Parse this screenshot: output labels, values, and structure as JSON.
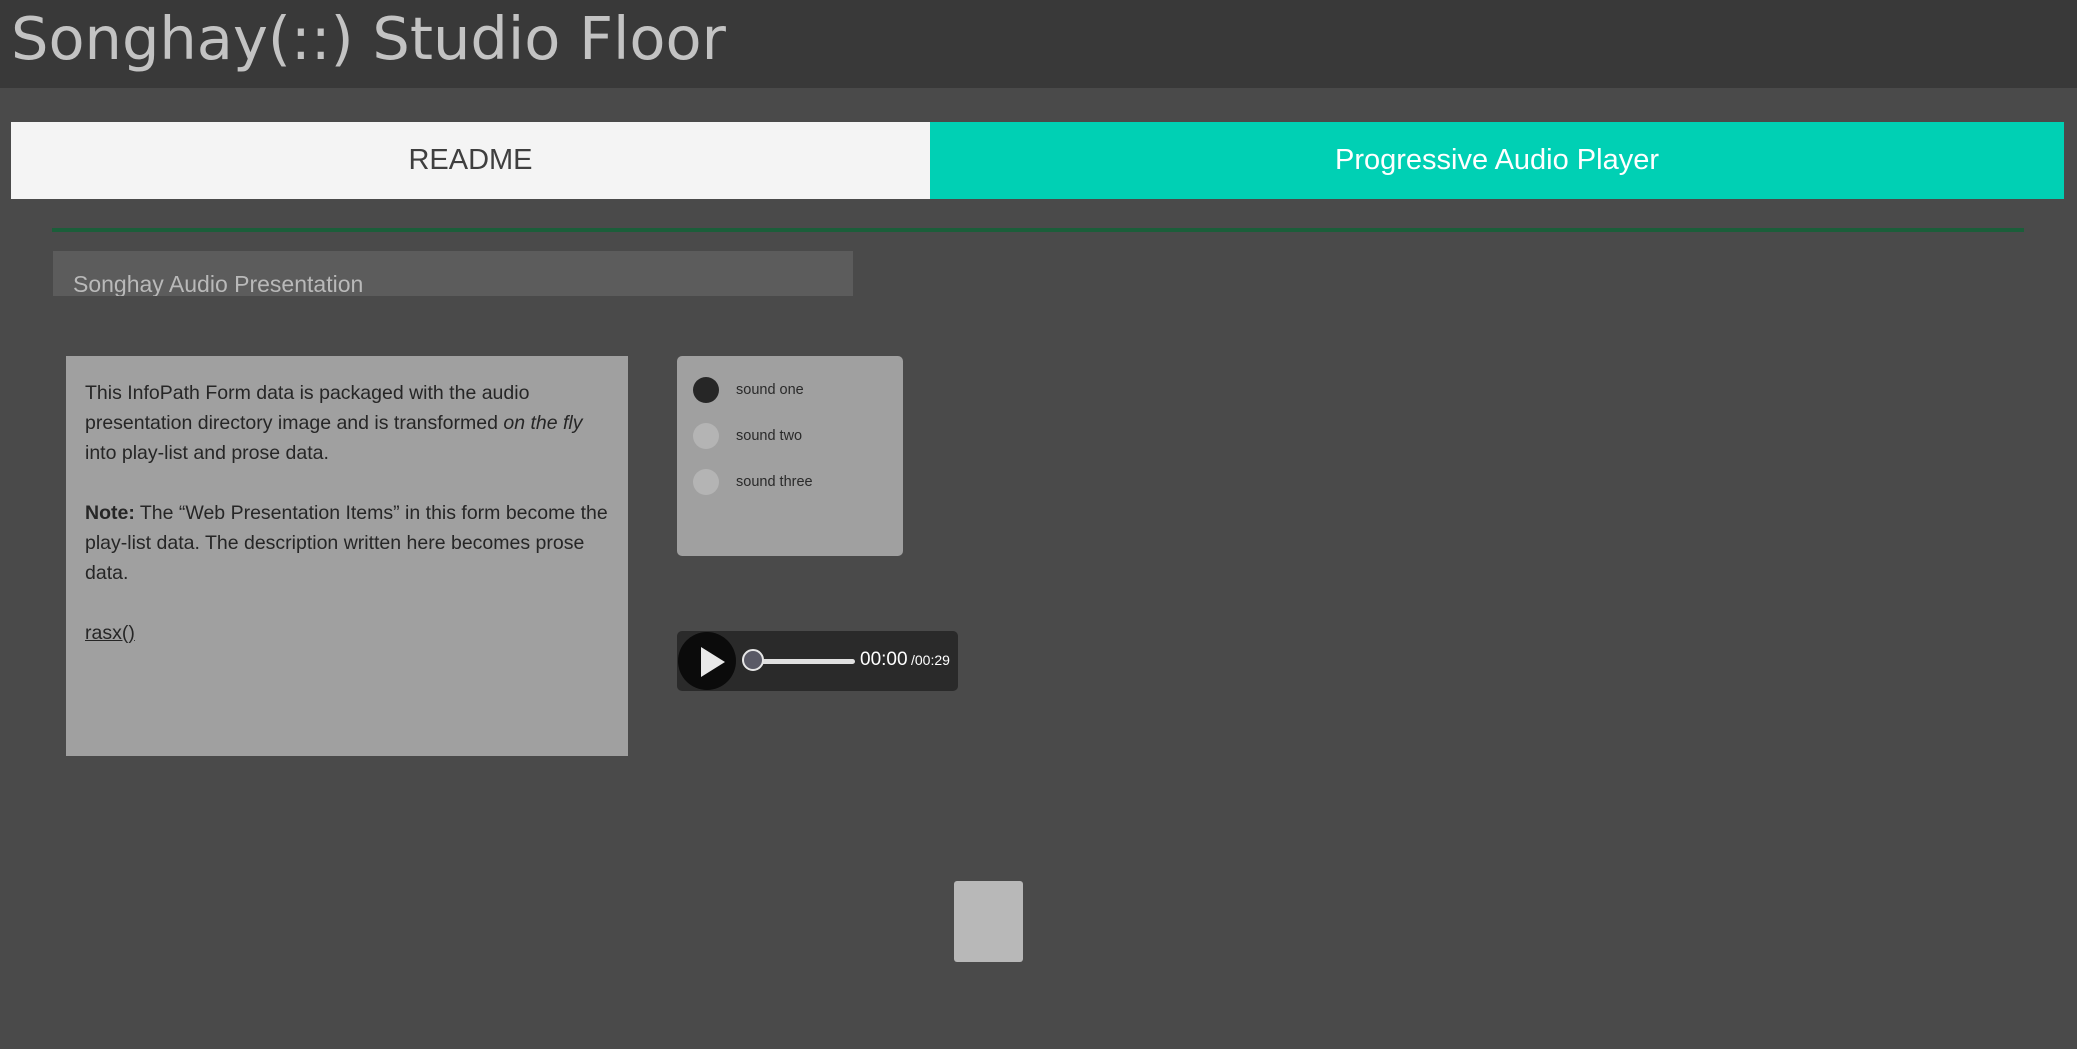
{
  "header": {
    "title": "Songhay(::) Studio Floor"
  },
  "tabs": [
    {
      "label": "README",
      "active": false
    },
    {
      "label": "Progressive Audio Player",
      "active": true
    }
  ],
  "colors": {
    "header_bg": "#393939",
    "page_bg": "#4a4a4a",
    "active_tab": "#00d0b4",
    "inactive_tab": "#f4f4f4",
    "divider": "#1b5e3a"
  },
  "presentation": {
    "title": "Songhay Audio Presentation",
    "prose": {
      "p1_start": "This InfoPath Form data is packaged with the audio presentation directory image and is transformed ",
      "p1_em": "on the fly",
      "p1_end": " into play-list and prose data.",
      "note_label": "Note:",
      "note_text": " The “Web Presentation Items” in this form become the play-list data. The description written here becomes prose data.",
      "link_text": "rasx()"
    },
    "playlist": [
      {
        "label": "sound one",
        "selected": true
      },
      {
        "label": "sound two",
        "selected": false
      },
      {
        "label": "sound three",
        "selected": false
      }
    ]
  },
  "player": {
    "play_icon": "play-icon",
    "current_time": "00:00",
    "total_time": "/00:29",
    "progress": 0
  }
}
